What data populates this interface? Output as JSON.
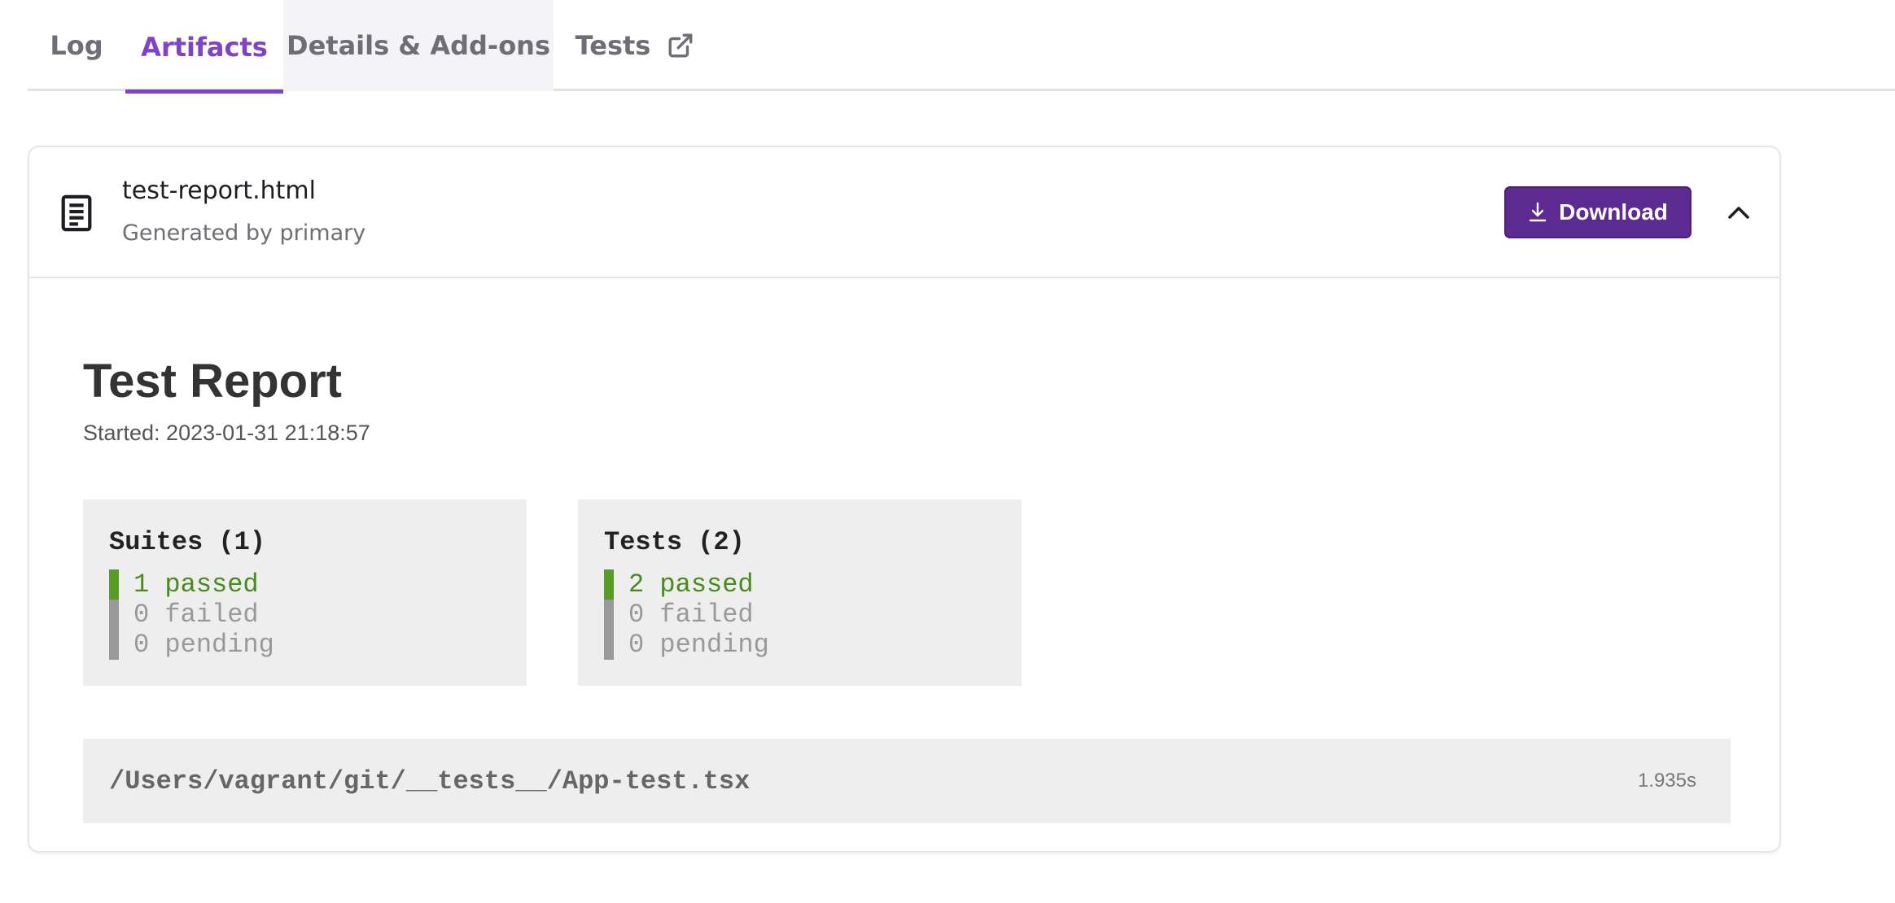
{
  "tabs": {
    "log": "Log",
    "artifacts": "Artifacts",
    "details": "Details & Add-ons",
    "tests": "Tests",
    "active": "Artifacts"
  },
  "artifact": {
    "name": "test-report.html",
    "subtitle": "Generated by primary",
    "download_label": "Download"
  },
  "report": {
    "title": "Test Report",
    "started": "Started: 2023-01-31 21:18:57",
    "suites": {
      "heading": "Suites (1)",
      "passed": "1 passed",
      "failed": "0 failed",
      "pending": "0 pending"
    },
    "tests": {
      "heading": "Tests (2)",
      "passed": "2 passed",
      "failed": "0 failed",
      "pending": "0 pending"
    },
    "files": [
      {
        "path": "/Users/vagrant/git/__tests__/App-test.tsx",
        "duration": "1.935s"
      }
    ]
  },
  "colors": {
    "accent": "#7f43c6",
    "button": "#5c2a91",
    "passed": "#4a8a1c",
    "neutral": "#999999"
  },
  "icons": {
    "external": "external-link-icon",
    "document": "document-icon",
    "download": "download-icon",
    "collapse": "chevron-up-icon"
  }
}
